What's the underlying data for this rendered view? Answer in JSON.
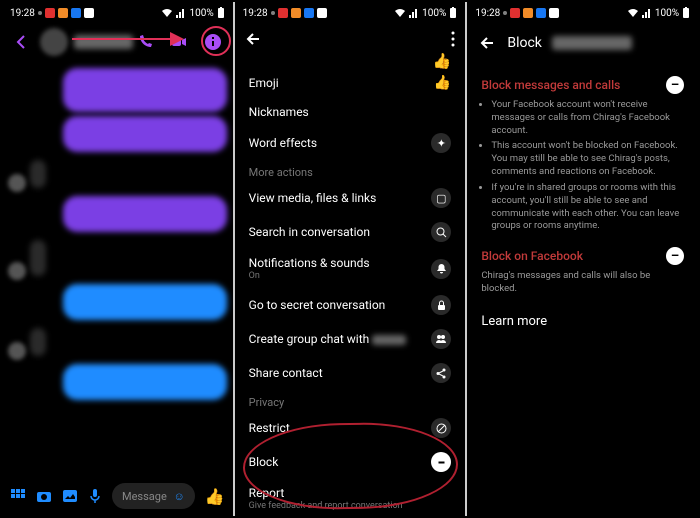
{
  "status": {
    "time": "19:28",
    "battery": "100%"
  },
  "panel1": {
    "input_placeholder": "Message"
  },
  "panel2": {
    "thumbs_up": "👍",
    "items": {
      "emoji": "Emoji",
      "nicknames": "Nicknames",
      "word_effects": "Word effects",
      "more_actions": "More actions",
      "view_media": "View media, files & links",
      "search": "Search in conversation",
      "notifications": "Notifications & sounds",
      "notifications_sub": "On",
      "secret": "Go to secret conversation",
      "group_chat": "Create group chat with",
      "share_contact": "Share contact",
      "privacy": "Privacy",
      "restrict": "Restrict",
      "block": "Block",
      "report": "Report",
      "report_sub": "Give feedback and report conversation"
    }
  },
  "panel3": {
    "title": "Block",
    "block_messages": {
      "title": "Block messages and calls",
      "b1": "Your Facebook account won't receive messages or calls from Chirag's Facebook account.",
      "b2": "This account won't be blocked on Facebook. You may still be able to see Chirag's posts, comments and reactions on Facebook.",
      "b3": "If you're in shared groups or rooms with this account, you'll still be able to see and communicate with each other. You can leave groups or rooms anytime."
    },
    "block_fb": {
      "title": "Block on Facebook",
      "sub": "Chirag's messages and calls will also be blocked."
    },
    "learn": "Learn more"
  }
}
